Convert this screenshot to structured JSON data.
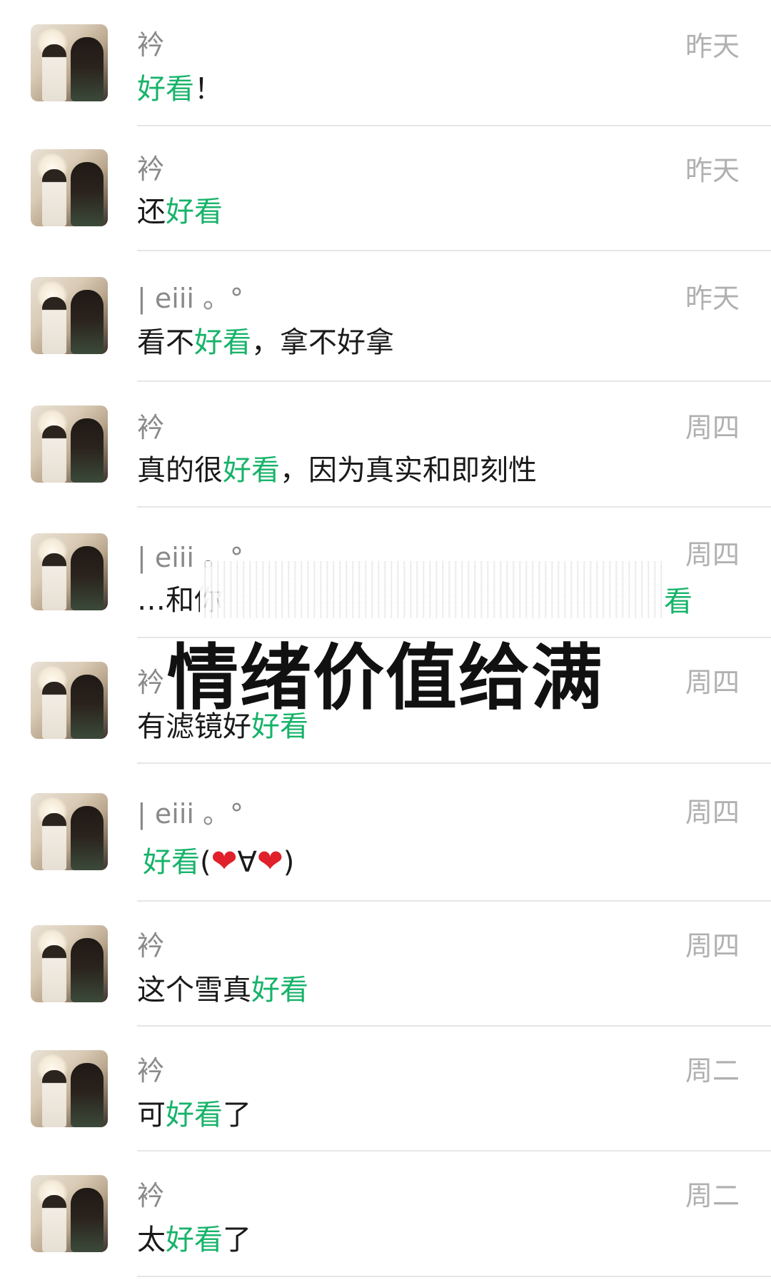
{
  "chat_list": [
    {
      "name": "衿",
      "time": "昨天",
      "before": "",
      "highlight": "好看",
      "after": "！"
    },
    {
      "name": "衿",
      "time": "昨天",
      "before": "还",
      "highlight": "好看",
      "after": ""
    },
    {
      "name": "| eiii 。°",
      "time": "昨天",
      "before": "看不",
      "highlight": "好看",
      "after": "，拿不好拿"
    },
    {
      "name": "衿",
      "time": "周四",
      "before": "真的很",
      "highlight": "好看",
      "after": "，因为真实和即刻性"
    },
    {
      "name": "| eiii 。°",
      "time": "周四",
      "before": "…和你",
      "highlight": "",
      "after": ""
    },
    {
      "name": "衿",
      "time": "周四",
      "before": "有滤镜好",
      "highlight": "好看",
      "after": ""
    },
    {
      "name": "| eiii 。°",
      "time": "周四",
      "before": "",
      "highlight": "好看",
      "after": "(❤∀❤)"
    },
    {
      "name": "衿",
      "time": "周四",
      "before": "这个雪真",
      "highlight": "好看",
      "after": ""
    },
    {
      "name": "衿",
      "time": "周二",
      "before": "可",
      "highlight": "好看",
      "after": "了"
    },
    {
      "name": "衿",
      "time": "周二",
      "before": "太",
      "highlight": "好看",
      "after": "了"
    }
  ],
  "overlay": {
    "caption": "情绪价值给满",
    "partial_highlight": "看"
  },
  "colors": {
    "highlight": "#17b36a",
    "name": "#8a8a8a",
    "time": "#b0b0b0",
    "divider": "#e6e6e6"
  }
}
